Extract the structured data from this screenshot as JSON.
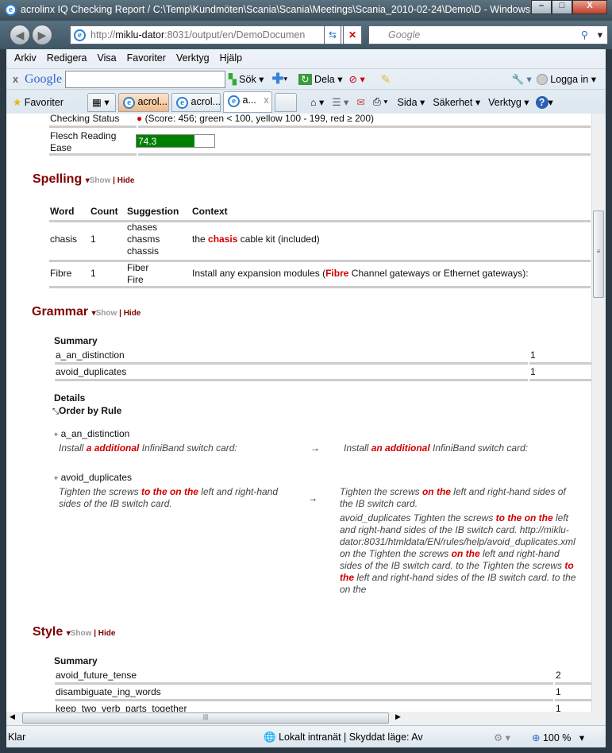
{
  "window": {
    "title": "acrolinx IQ Checking Report / C:\\Temp\\Kundmöten\\Scania\\Scania\\Meetings\\Scania_2010-02-24\\Demo\\D - Windows I...",
    "url_prefix": "http://",
    "url_host": "miklu-dator",
    "url_rest": ":8031/output/en/DemoDocumen",
    "search_placeholder": "Google"
  },
  "menu": [
    "Arkiv",
    "Redigera",
    "Visa",
    "Favoriter",
    "Verktyg",
    "Hjälp"
  ],
  "google_bar": {
    "logo": "Google",
    "search_label": "Sök",
    "share_label": "Dela",
    "login_label": "Logga in",
    "close": "x"
  },
  "tabbar": {
    "favorites": "Favoriter",
    "tabs": [
      "acrol...",
      "acrol...",
      "a..."
    ],
    "tab_close": "x",
    "tools": [
      "Sida",
      "Säkerhet",
      "Verktyg"
    ]
  },
  "report": {
    "checking_status_label": "Checking Status",
    "checking_status_value": "(Score: 456; green < 100, yellow 100 - 199, red ≥ 200)",
    "status_color": "#e00000",
    "flesch_label": "Flesch Reading Ease",
    "flesch_value": "74.3",
    "flesch_percent": 74.3,
    "flesch_color": "#008000",
    "show": "Show",
    "hide": "Hide",
    "sep": "|",
    "spelling": {
      "title": "Spelling",
      "headers": [
        "Word",
        "Count",
        "Suggestion",
        "Context"
      ],
      "rows": [
        {
          "word": "chasis",
          "count": "1",
          "suggestions": [
            "chases",
            "chasms",
            "chassis"
          ],
          "context": [
            {
              "t": "the "
            },
            {
              "t": "chasis",
              "hl": true
            },
            {
              "t": " cable kit (included)"
            }
          ]
        },
        {
          "word": "Fibre",
          "count": "1",
          "suggestions": [
            "Fiber",
            "Fire"
          ],
          "context": [
            {
              "t": "Install any expansion modules ("
            },
            {
              "t": "Fibre",
              "hl": true
            },
            {
              "t": " Channel gateways or Ethernet gateways):"
            }
          ]
        }
      ]
    },
    "grammar": {
      "title": "Grammar",
      "summary_label": "Summary",
      "summary": [
        {
          "rule": "a_an_distinction",
          "count": "1"
        },
        {
          "rule": "avoid_duplicates",
          "count": "1"
        }
      ],
      "details_label": "Details",
      "order_label": "Order by Rule",
      "arrow": "→",
      "details": [
        {
          "rule": "a_an_distinction",
          "original": [
            {
              "t": "Install "
            },
            {
              "t": "a additional",
              "hl": true
            },
            {
              "t": " InfiniBand switch card:"
            }
          ],
          "suggestion": [
            {
              "t": "Install "
            },
            {
              "t": "an additional",
              "hl": true
            },
            {
              "t": " InfiniBand switch card:"
            }
          ]
        },
        {
          "rule": "avoid_duplicates",
          "original": [
            {
              "t": "Tighten the screws "
            },
            {
              "t": "to the on the",
              "hl": true
            },
            {
              "t": " left and right-hand sides of the IB switch card."
            }
          ],
          "suggestion": [
            {
              "t": "Tighten the screws "
            },
            {
              "t": "on the",
              "hl": true
            },
            {
              "t": " left and right-hand sides of the IB switch card."
            }
          ],
          "extra": [
            {
              "t": "avoid_duplicates Tighten the screws "
            },
            {
              "t": "to the on the",
              "hl": true
            },
            {
              "t": " left and right-hand sides of the IB switch card. http://miklu-dator:8031/htmldata/EN/rules/help/avoid_duplicates.xml on the Tighten the screws "
            },
            {
              "t": "on the",
              "hl": true
            },
            {
              "t": " left and right-hand sides of the IB switch card. to the Tighten the screws "
            },
            {
              "t": "to the",
              "hl": true
            },
            {
              "t": " left and right-hand sides of the IB switch card. to the on the"
            }
          ]
        }
      ]
    },
    "style": {
      "title": "Style",
      "summary_label": "Summary",
      "summary": [
        {
          "rule": "avoid_future_tense",
          "count": "2"
        },
        {
          "rule": "disambiguate_ing_words",
          "count": "1"
        },
        {
          "rule": "keep_two_verb_parts_together",
          "count": "1"
        }
      ]
    }
  },
  "statusbar": {
    "left": "Klar",
    "zone": "Lokalt intranät | Skyddat läge: Av",
    "zoom": "100 %"
  }
}
